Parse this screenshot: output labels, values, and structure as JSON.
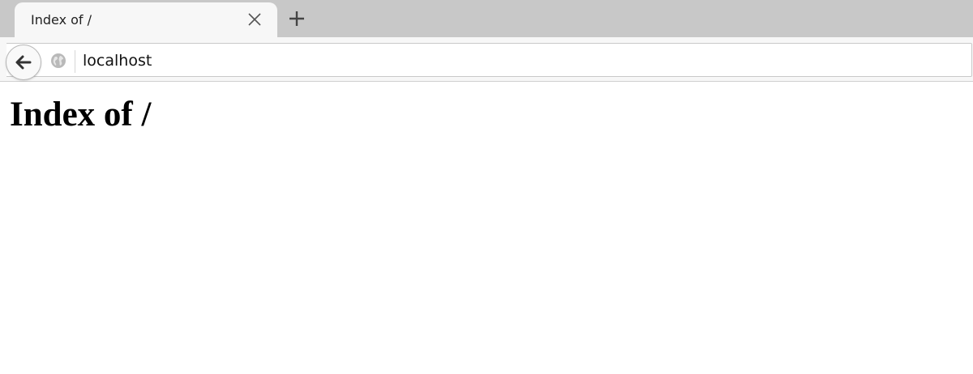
{
  "browser": {
    "tab": {
      "title": "Index of /"
    },
    "address_bar": {
      "url": "localhost"
    }
  },
  "page": {
    "heading": "Index of /"
  }
}
